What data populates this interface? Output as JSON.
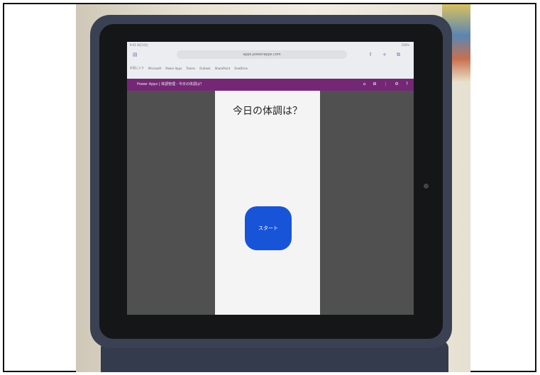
{
  "browser": {
    "status_left": "9:41 8月10日",
    "status_right": "100%",
    "url": "apps.powerapps.com"
  },
  "bookmarks": [
    "お気に入り",
    "Microsoft",
    "Power Apps",
    "Teams",
    "Outlook",
    "SharePoint",
    "OneDrive"
  ],
  "app": {
    "title": "Power Apps | 体調管理 - 今日の体調は？",
    "actions": [
      "⌂",
      "⊞",
      "⋮",
      "⚙",
      "?"
    ]
  },
  "screen": {
    "question": "今日の体調は？",
    "start_button": "スタート"
  },
  "colors": {
    "app_bar": "#742774",
    "start_button": "#1754d8",
    "canvas": "#f4f4f4"
  }
}
